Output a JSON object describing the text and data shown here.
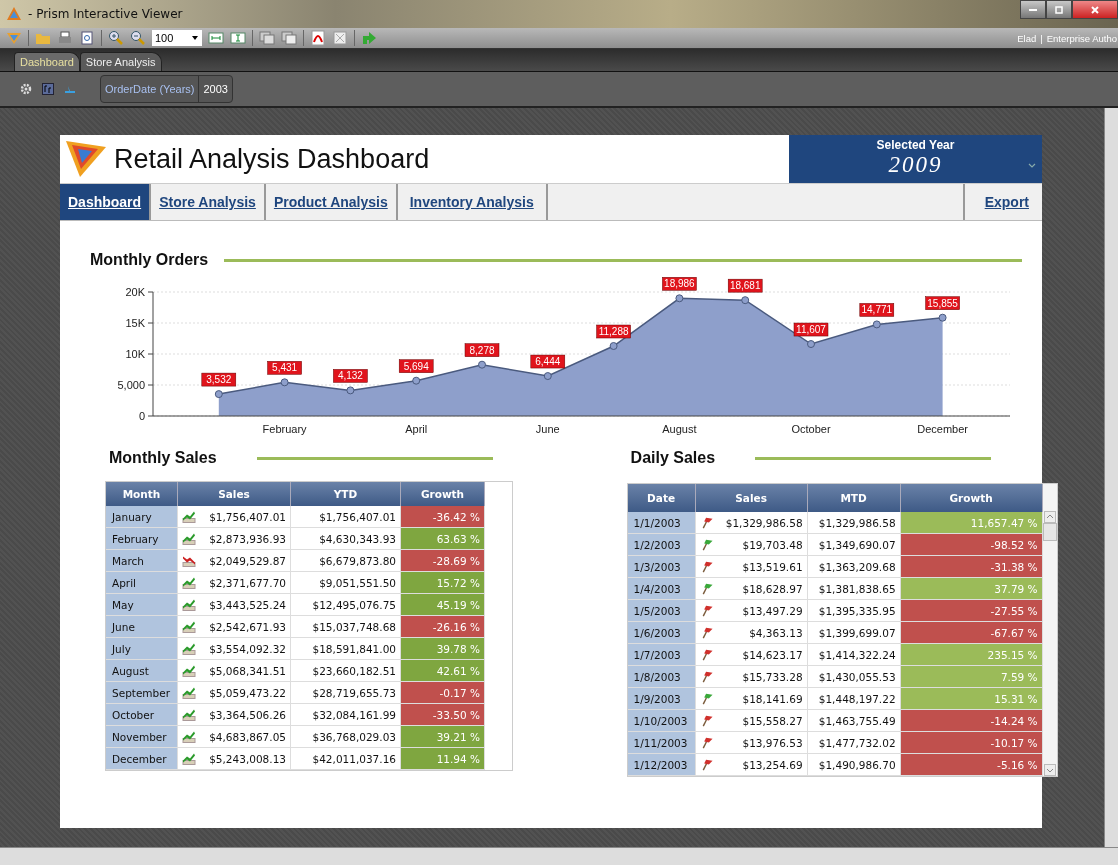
{
  "window": {
    "title": "- Prism Interactive Viewer"
  },
  "toolbar": {
    "zoom": "100",
    "user": "Elad",
    "separator": "|",
    "role": "Enterprise Autho"
  },
  "tabs": [
    {
      "label": "Dashboard",
      "selected": true
    },
    {
      "label": "Store Analysis",
      "selected": false
    }
  ],
  "filter": {
    "field": "OrderDate (Years)",
    "value": "2003"
  },
  "dashboard": {
    "title": "Retail Analysis Dashboard",
    "year_label": "Selected Year",
    "year": "2009",
    "nav": [
      {
        "label": "Dashboard",
        "selected": true
      },
      {
        "label": "Store Analysis",
        "selected": false
      },
      {
        "label": "Product Analysis",
        "selected": false
      },
      {
        "label": "Inventory Analysis",
        "selected": false
      }
    ],
    "export": "Export"
  },
  "monthly_orders": {
    "title": "Monthly Orders",
    "chart_data": {
      "type": "area",
      "categories": [
        null,
        "February",
        null,
        "April",
        null,
        "June",
        null,
        "August",
        null,
        "October",
        null,
        "December"
      ],
      "series": [
        {
          "color": "#8e9fcb",
          "values": [
            3532,
            5431,
            4132,
            5694,
            8278,
            6444,
            11288,
            18986,
            18681,
            11607,
            14771,
            15855
          ]
        }
      ],
      "value_labels": [
        "3,532",
        "5,431",
        "4,132",
        "5,694",
        "8,278",
        "6,444",
        "11,288",
        "18,986",
        "18,681",
        "11,607",
        "14,771",
        "15,855"
      ],
      "grid": true,
      "ylim": [
        0,
        20000
      ],
      "yticks": [
        {
          "value": 0,
          "label": "0"
        },
        {
          "value": 5000,
          "label": "5,000"
        },
        {
          "value": 10000,
          "label": "10K"
        },
        {
          "value": 15000,
          "label": "15K"
        },
        {
          "value": 20000,
          "label": "20K"
        }
      ]
    }
  },
  "monthly_sales": {
    "title": "Monthly Sales",
    "columns": [
      "Month",
      "Sales",
      "YTD",
      "Growth"
    ],
    "rows": [
      {
        "month": "January",
        "rising": true,
        "sales": "$1,756,407.01",
        "ytd": "$1,756,407.01",
        "growth": "-36.42 %",
        "positive": false
      },
      {
        "month": "February",
        "rising": true,
        "sales": "$2,873,936.93",
        "ytd": "$4,630,343.93",
        "growth": "63.63 %",
        "positive": true
      },
      {
        "month": "March",
        "rising": false,
        "sales": "$2,049,529.87",
        "ytd": "$6,679,873.80",
        "growth": "-28.69 %",
        "positive": false
      },
      {
        "month": "April",
        "rising": true,
        "sales": "$2,371,677.70",
        "ytd": "$9,051,551.50",
        "growth": "15.72 %",
        "positive": true
      },
      {
        "month": "May",
        "rising": true,
        "sales": "$3,443,525.24",
        "ytd": "$12,495,076.75",
        "growth": "45.19 %",
        "positive": true
      },
      {
        "month": "June",
        "rising": true,
        "sales": "$2,542,671.93",
        "ytd": "$15,037,748.68",
        "growth": "-26.16 %",
        "positive": false
      },
      {
        "month": "July",
        "rising": true,
        "sales": "$3,554,092.32",
        "ytd": "$18,591,841.00",
        "growth": "39.78 %",
        "positive": true
      },
      {
        "month": "August",
        "rising": true,
        "sales": "$5,068,341.51",
        "ytd": "$23,660,182.51",
        "growth": "42.61 %",
        "positive": true
      },
      {
        "month": "September",
        "rising": true,
        "sales": "$5,059,473.22",
        "ytd": "$28,719,655.73",
        "growth": "-0.17 %",
        "positive": false
      },
      {
        "month": "October",
        "rising": true,
        "sales": "$3,364,506.26",
        "ytd": "$32,084,161.99",
        "growth": "-33.50 %",
        "positive": false
      },
      {
        "month": "November",
        "rising": true,
        "sales": "$4,683,867.05",
        "ytd": "$36,768,029.03",
        "growth": "39.21 %",
        "positive": true
      },
      {
        "month": "December",
        "rising": true,
        "sales": "$5,243,008.13",
        "ytd": "$42,011,037.16",
        "growth": "11.94 %",
        "positive": true
      }
    ]
  },
  "daily_sales": {
    "title": "Daily Sales",
    "columns": [
      "Date",
      "Sales",
      "MTD",
      "Growth"
    ],
    "rows": [
      {
        "date": "1/1/2003",
        "rising": false,
        "sales": "$1,329,986.58",
        "mtd": "$1,329,986.58",
        "growth": "11,657.47 %",
        "positive": true
      },
      {
        "date": "1/2/2003",
        "rising": true,
        "sales": "$19,703.48",
        "mtd": "$1,349,690.07",
        "growth": "-98.52 %",
        "positive": false
      },
      {
        "date": "1/3/2003",
        "rising": false,
        "sales": "$13,519.61",
        "mtd": "$1,363,209.68",
        "growth": "-31.38 %",
        "positive": false
      },
      {
        "date": "1/4/2003",
        "rising": true,
        "sales": "$18,628.97",
        "mtd": "$1,381,838.65",
        "growth": "37.79 %",
        "positive": true
      },
      {
        "date": "1/5/2003",
        "rising": false,
        "sales": "$13,497.29",
        "mtd": "$1,395,335.95",
        "growth": "-27.55 %",
        "positive": false
      },
      {
        "date": "1/6/2003",
        "rising": false,
        "sales": "$4,363.13",
        "mtd": "$1,399,699.07",
        "growth": "-67.67 %",
        "positive": false
      },
      {
        "date": "1/7/2003",
        "rising": false,
        "sales": "$14,623.17",
        "mtd": "$1,414,322.24",
        "growth": "235.15 %",
        "positive": true
      },
      {
        "date": "1/8/2003",
        "rising": false,
        "sales": "$15,733.28",
        "mtd": "$1,430,055.53",
        "growth": "7.59 %",
        "positive": true
      },
      {
        "date": "1/9/2003",
        "rising": true,
        "sales": "$18,141.69",
        "mtd": "$1,448,197.22",
        "growth": "15.31 %",
        "positive": true
      },
      {
        "date": "1/10/2003",
        "rising": false,
        "sales": "$15,558.27",
        "mtd": "$1,463,755.49",
        "growth": "-14.24 %",
        "positive": false
      },
      {
        "date": "1/11/2003",
        "rising": false,
        "sales": "$13,976.53",
        "mtd": "$1,477,732.02",
        "growth": "-10.17 %",
        "positive": false
      },
      {
        "date": "1/12/2003",
        "rising": false,
        "sales": "$13,254.69",
        "mtd": "$1,490,986.70",
        "growth": "-5.16 %",
        "positive": false
      }
    ]
  }
}
